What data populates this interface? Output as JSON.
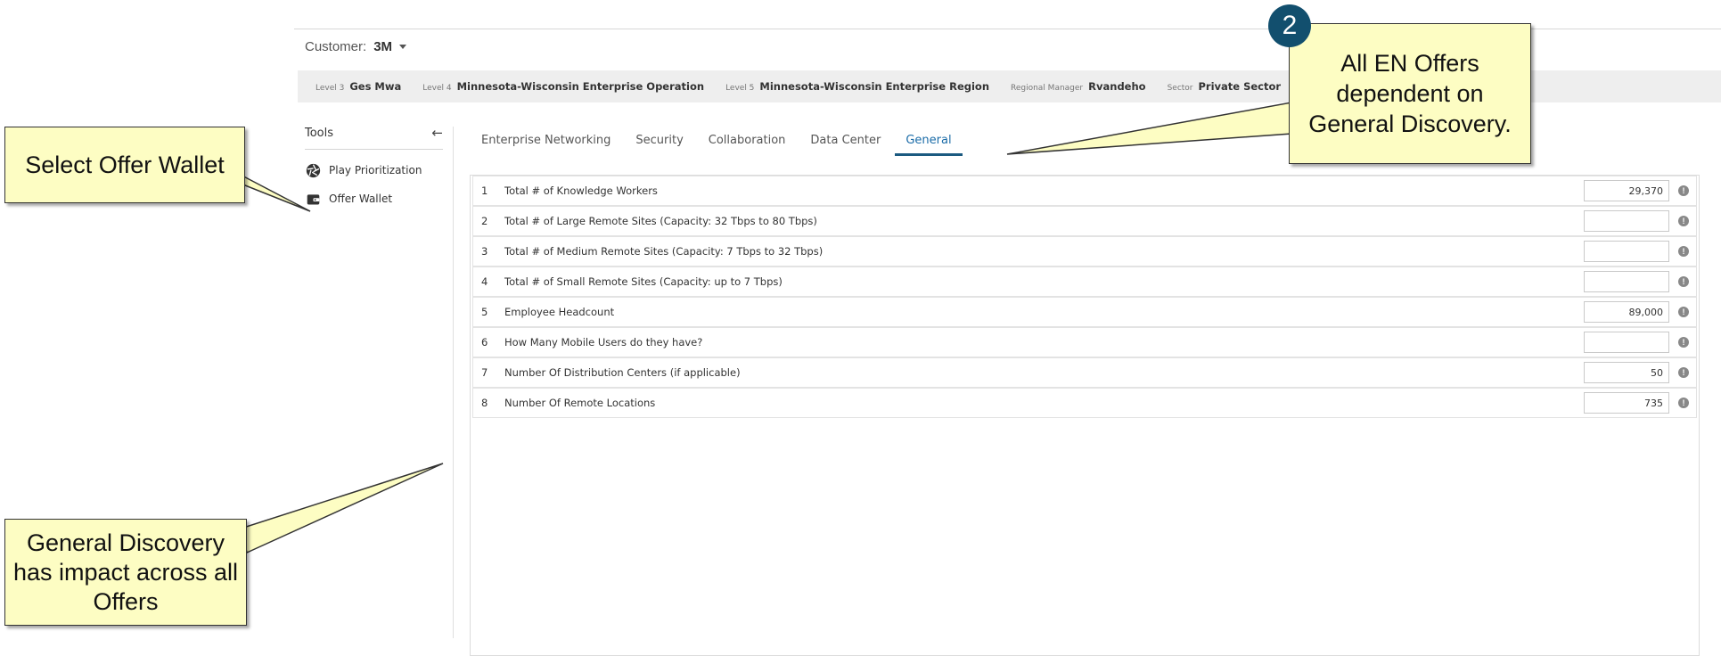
{
  "customer": {
    "label": "Customer:",
    "value": "3M"
  },
  "hierarchy": [
    {
      "label": "Level 3",
      "value": "Ges Mwa"
    },
    {
      "label": "Level 4",
      "value": "Minnesota-Wisconsin Enterprise Operation"
    },
    {
      "label": "Level 5",
      "value": "Minnesota-Wisconsin Enterprise Region"
    },
    {
      "label": "Regional Manager",
      "value": "Rvandeho"
    },
    {
      "label": "Sector",
      "value": "Private Sector"
    }
  ],
  "tools": {
    "title": "Tools",
    "items": [
      {
        "label": "Play Prioritization",
        "icon": "aperture-icon"
      },
      {
        "label": "Offer Wallet",
        "icon": "wallet-icon"
      }
    ]
  },
  "tabs": [
    "Enterprise Networking",
    "Security",
    "Collaboration",
    "Data Center",
    "General"
  ],
  "active_tab": "General",
  "questions": [
    {
      "num": "1",
      "text": "Total # of Knowledge Workers",
      "value": "29,370"
    },
    {
      "num": "2",
      "text": "Total # of Large Remote Sites (Capacity: 32 Tbps to 80 Tbps)",
      "value": ""
    },
    {
      "num": "3",
      "text": "Total # of Medium Remote Sites (Capacity: 7 Tbps to 32 Tbps)",
      "value": ""
    },
    {
      "num": "4",
      "text": "Total # of Small Remote Sites (Capacity: up to 7 Tbps)",
      "value": ""
    },
    {
      "num": "5",
      "text": "Employee Headcount",
      "value": "89,000"
    },
    {
      "num": "6",
      "text": "How Many Mobile Users do they have?",
      "value": ""
    },
    {
      "num": "7",
      "text": "Number Of Distribution Centers (if applicable)",
      "value": "50"
    },
    {
      "num": "8",
      "text": "Number Of Remote Locations",
      "value": "735"
    }
  ],
  "info_glyph": "!",
  "callouts": {
    "select_wallet": "Select Offer Wallet",
    "impact": "General Discovery has impact across all Offers",
    "dependent": "All EN Offers dependent on General Discovery.",
    "step_badge": "2"
  },
  "colors": {
    "callout_fill": "#fdfdc3",
    "badge": "#124f6e",
    "active_tab": "#1b6ca8",
    "hierarchy_bar": "#eeeeee"
  }
}
